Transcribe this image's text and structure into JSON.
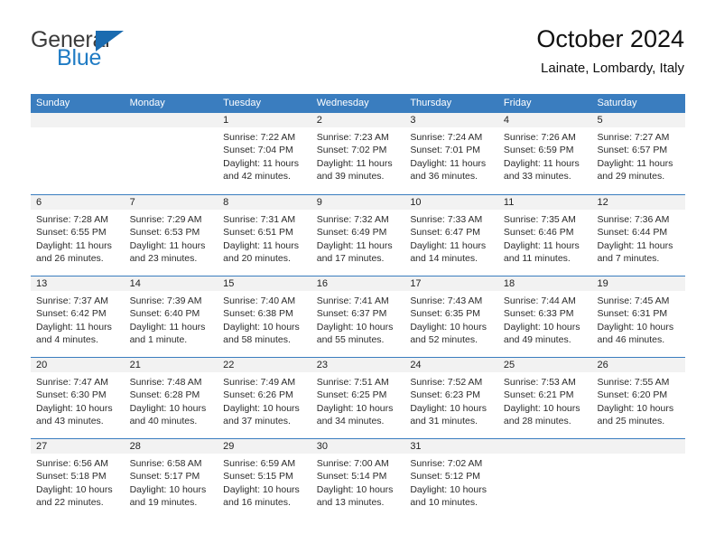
{
  "brand": {
    "name_top": "General",
    "name_bottom": "Blue",
    "accent_color": "#1f7bc4",
    "triangle_icon": "brand-triangle-icon"
  },
  "header": {
    "title": "October 2024",
    "subtitle": "Lainate, Lombardy, Italy"
  },
  "colors": {
    "header_blue": "#3a7dbf",
    "daynum_gray": "#f2f2f2",
    "text": "#2b2b2b"
  },
  "weekdays": [
    "Sunday",
    "Monday",
    "Tuesday",
    "Wednesday",
    "Thursday",
    "Friday",
    "Saturday"
  ],
  "weeks": [
    [
      {
        "day": "",
        "sunrise": "",
        "sunset": "",
        "daylight_1": "",
        "daylight_2": ""
      },
      {
        "day": "",
        "sunrise": "",
        "sunset": "",
        "daylight_1": "",
        "daylight_2": ""
      },
      {
        "day": "1",
        "sunrise": "Sunrise: 7:22 AM",
        "sunset": "Sunset: 7:04 PM",
        "daylight_1": "Daylight: 11 hours",
        "daylight_2": "and 42 minutes."
      },
      {
        "day": "2",
        "sunrise": "Sunrise: 7:23 AM",
        "sunset": "Sunset: 7:02 PM",
        "daylight_1": "Daylight: 11 hours",
        "daylight_2": "and 39 minutes."
      },
      {
        "day": "3",
        "sunrise": "Sunrise: 7:24 AM",
        "sunset": "Sunset: 7:01 PM",
        "daylight_1": "Daylight: 11 hours",
        "daylight_2": "and 36 minutes."
      },
      {
        "day": "4",
        "sunrise": "Sunrise: 7:26 AM",
        "sunset": "Sunset: 6:59 PM",
        "daylight_1": "Daylight: 11 hours",
        "daylight_2": "and 33 minutes."
      },
      {
        "day": "5",
        "sunrise": "Sunrise: 7:27 AM",
        "sunset": "Sunset: 6:57 PM",
        "daylight_1": "Daylight: 11 hours",
        "daylight_2": "and 29 minutes."
      }
    ],
    [
      {
        "day": "6",
        "sunrise": "Sunrise: 7:28 AM",
        "sunset": "Sunset: 6:55 PM",
        "daylight_1": "Daylight: 11 hours",
        "daylight_2": "and 26 minutes."
      },
      {
        "day": "7",
        "sunrise": "Sunrise: 7:29 AM",
        "sunset": "Sunset: 6:53 PM",
        "daylight_1": "Daylight: 11 hours",
        "daylight_2": "and 23 minutes."
      },
      {
        "day": "8",
        "sunrise": "Sunrise: 7:31 AM",
        "sunset": "Sunset: 6:51 PM",
        "daylight_1": "Daylight: 11 hours",
        "daylight_2": "and 20 minutes."
      },
      {
        "day": "9",
        "sunrise": "Sunrise: 7:32 AM",
        "sunset": "Sunset: 6:49 PM",
        "daylight_1": "Daylight: 11 hours",
        "daylight_2": "and 17 minutes."
      },
      {
        "day": "10",
        "sunrise": "Sunrise: 7:33 AM",
        "sunset": "Sunset: 6:47 PM",
        "daylight_1": "Daylight: 11 hours",
        "daylight_2": "and 14 minutes."
      },
      {
        "day": "11",
        "sunrise": "Sunrise: 7:35 AM",
        "sunset": "Sunset: 6:46 PM",
        "daylight_1": "Daylight: 11 hours",
        "daylight_2": "and 11 minutes."
      },
      {
        "day": "12",
        "sunrise": "Sunrise: 7:36 AM",
        "sunset": "Sunset: 6:44 PM",
        "daylight_1": "Daylight: 11 hours",
        "daylight_2": "and 7 minutes."
      }
    ],
    [
      {
        "day": "13",
        "sunrise": "Sunrise: 7:37 AM",
        "sunset": "Sunset: 6:42 PM",
        "daylight_1": "Daylight: 11 hours",
        "daylight_2": "and 4 minutes."
      },
      {
        "day": "14",
        "sunrise": "Sunrise: 7:39 AM",
        "sunset": "Sunset: 6:40 PM",
        "daylight_1": "Daylight: 11 hours",
        "daylight_2": "and 1 minute."
      },
      {
        "day": "15",
        "sunrise": "Sunrise: 7:40 AM",
        "sunset": "Sunset: 6:38 PM",
        "daylight_1": "Daylight: 10 hours",
        "daylight_2": "and 58 minutes."
      },
      {
        "day": "16",
        "sunrise": "Sunrise: 7:41 AM",
        "sunset": "Sunset: 6:37 PM",
        "daylight_1": "Daylight: 10 hours",
        "daylight_2": "and 55 minutes."
      },
      {
        "day": "17",
        "sunrise": "Sunrise: 7:43 AM",
        "sunset": "Sunset: 6:35 PM",
        "daylight_1": "Daylight: 10 hours",
        "daylight_2": "and 52 minutes."
      },
      {
        "day": "18",
        "sunrise": "Sunrise: 7:44 AM",
        "sunset": "Sunset: 6:33 PM",
        "daylight_1": "Daylight: 10 hours",
        "daylight_2": "and 49 minutes."
      },
      {
        "day": "19",
        "sunrise": "Sunrise: 7:45 AM",
        "sunset": "Sunset: 6:31 PM",
        "daylight_1": "Daylight: 10 hours",
        "daylight_2": "and 46 minutes."
      }
    ],
    [
      {
        "day": "20",
        "sunrise": "Sunrise: 7:47 AM",
        "sunset": "Sunset: 6:30 PM",
        "daylight_1": "Daylight: 10 hours",
        "daylight_2": "and 43 minutes."
      },
      {
        "day": "21",
        "sunrise": "Sunrise: 7:48 AM",
        "sunset": "Sunset: 6:28 PM",
        "daylight_1": "Daylight: 10 hours",
        "daylight_2": "and 40 minutes."
      },
      {
        "day": "22",
        "sunrise": "Sunrise: 7:49 AM",
        "sunset": "Sunset: 6:26 PM",
        "daylight_1": "Daylight: 10 hours",
        "daylight_2": "and 37 minutes."
      },
      {
        "day": "23",
        "sunrise": "Sunrise: 7:51 AM",
        "sunset": "Sunset: 6:25 PM",
        "daylight_1": "Daylight: 10 hours",
        "daylight_2": "and 34 minutes."
      },
      {
        "day": "24",
        "sunrise": "Sunrise: 7:52 AM",
        "sunset": "Sunset: 6:23 PM",
        "daylight_1": "Daylight: 10 hours",
        "daylight_2": "and 31 minutes."
      },
      {
        "day": "25",
        "sunrise": "Sunrise: 7:53 AM",
        "sunset": "Sunset: 6:21 PM",
        "daylight_1": "Daylight: 10 hours",
        "daylight_2": "and 28 minutes."
      },
      {
        "day": "26",
        "sunrise": "Sunrise: 7:55 AM",
        "sunset": "Sunset: 6:20 PM",
        "daylight_1": "Daylight: 10 hours",
        "daylight_2": "and 25 minutes."
      }
    ],
    [
      {
        "day": "27",
        "sunrise": "Sunrise: 6:56 AM",
        "sunset": "Sunset: 5:18 PM",
        "daylight_1": "Daylight: 10 hours",
        "daylight_2": "and 22 minutes."
      },
      {
        "day": "28",
        "sunrise": "Sunrise: 6:58 AM",
        "sunset": "Sunset: 5:17 PM",
        "daylight_1": "Daylight: 10 hours",
        "daylight_2": "and 19 minutes."
      },
      {
        "day": "29",
        "sunrise": "Sunrise: 6:59 AM",
        "sunset": "Sunset: 5:15 PM",
        "daylight_1": "Daylight: 10 hours",
        "daylight_2": "and 16 minutes."
      },
      {
        "day": "30",
        "sunrise": "Sunrise: 7:00 AM",
        "sunset": "Sunset: 5:14 PM",
        "daylight_1": "Daylight: 10 hours",
        "daylight_2": "and 13 minutes."
      },
      {
        "day": "31",
        "sunrise": "Sunrise: 7:02 AM",
        "sunset": "Sunset: 5:12 PM",
        "daylight_1": "Daylight: 10 hours",
        "daylight_2": "and 10 minutes."
      },
      {
        "day": "",
        "sunrise": "",
        "sunset": "",
        "daylight_1": "",
        "daylight_2": ""
      },
      {
        "day": "",
        "sunrise": "",
        "sunset": "",
        "daylight_1": "",
        "daylight_2": ""
      }
    ]
  ]
}
